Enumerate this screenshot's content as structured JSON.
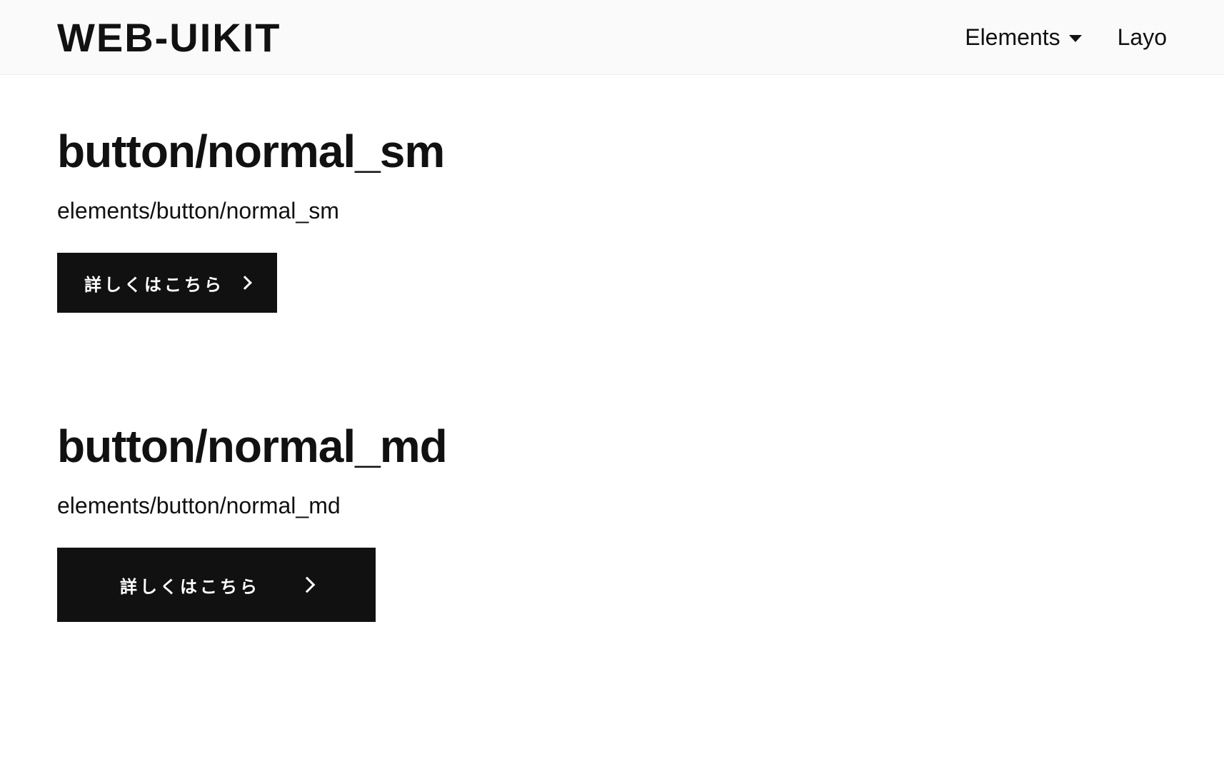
{
  "header": {
    "logo": "WEB-UIKIT",
    "nav": {
      "elements": "Elements",
      "layout": "Layo"
    }
  },
  "sections": {
    "normal_sm": {
      "title": "button/normal_sm",
      "path": "elements/button/normal_sm",
      "button_label": "詳しくはこちら"
    },
    "normal_md": {
      "title": "button/normal_md",
      "path": "elements/button/normal_md",
      "button_label": "詳しくはこちら"
    }
  }
}
